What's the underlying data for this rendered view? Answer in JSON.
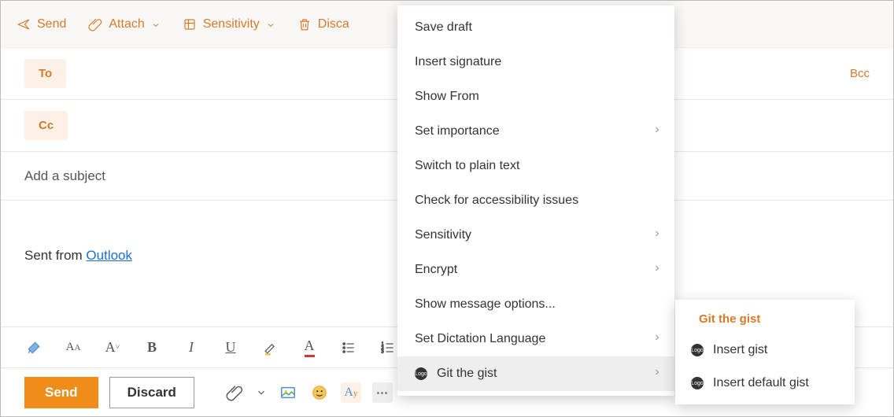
{
  "toolbar": {
    "send": "Send",
    "attach": "Attach",
    "sensitivity": "Sensitivity",
    "discard": "Disca"
  },
  "fields": {
    "to": "To",
    "cc": "Cc",
    "bcc": "Bcc",
    "subject_placeholder": "Add a subject"
  },
  "body": {
    "prefix": "Sent from ",
    "link_text": "Outlook"
  },
  "bottom": {
    "send": "Send",
    "discard": "Discard"
  },
  "menu": {
    "items": [
      {
        "label": "Save draft",
        "submenu": false
      },
      {
        "label": "Insert signature",
        "submenu": false
      },
      {
        "label": "Show From",
        "submenu": false
      },
      {
        "label": "Set importance",
        "submenu": true
      },
      {
        "label": "Switch to plain text",
        "submenu": false
      },
      {
        "label": "Check for accessibility issues",
        "submenu": false
      },
      {
        "label": "Sensitivity",
        "submenu": true
      },
      {
        "label": "Encrypt",
        "submenu": true
      },
      {
        "label": "Show message options...",
        "submenu": false
      },
      {
        "label": "Set Dictation Language",
        "submenu": true
      },
      {
        "label": "Git the gist",
        "submenu": true,
        "icon": true,
        "hover": true
      }
    ]
  },
  "submenu": {
    "title": "Git the gist",
    "items": [
      {
        "label": "Insert gist"
      },
      {
        "label": "Insert default gist"
      }
    ]
  }
}
